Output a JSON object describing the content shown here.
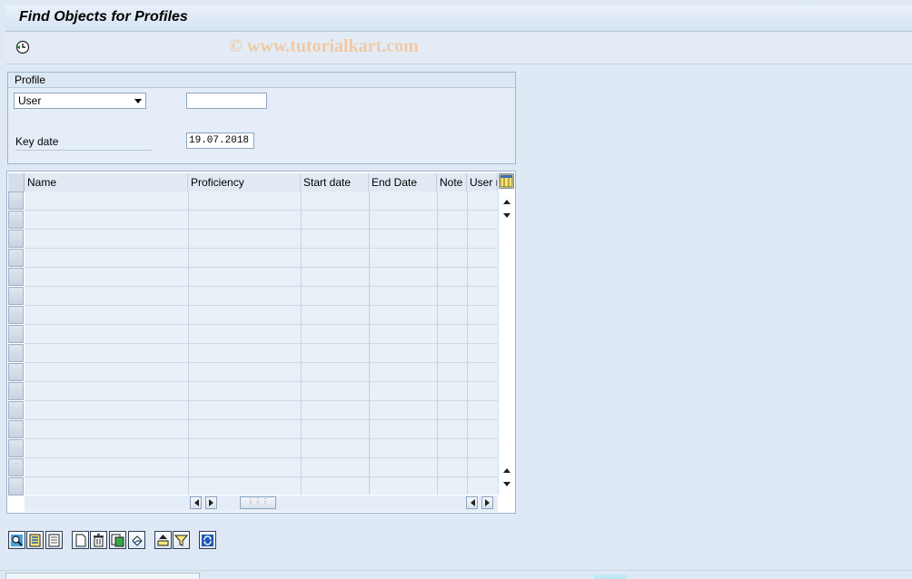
{
  "window": {
    "title": "Find Objects for Profiles"
  },
  "watermark": "© www.tutorialkart.com",
  "app_toolbar": {
    "execute_icon": "execute-clock-icon"
  },
  "profile_group": {
    "title": "Profile",
    "type_select": {
      "value": "User"
    },
    "object_input": {
      "value": ""
    },
    "key_date": {
      "label": "Key date",
      "value": "19.07.2018"
    }
  },
  "grid": {
    "columns": [
      "Name",
      "Proficiency",
      "Start date",
      "End Date",
      "Note",
      "User r"
    ],
    "layout_icon": "column-layout-icon",
    "rows": []
  },
  "bottom_toolbar": {
    "buttons": [
      {
        "name": "details-button",
        "icon": "magnifier-icon"
      },
      {
        "name": "select-all-button",
        "icon": "select-all-icon"
      },
      {
        "name": "deselect-all-button",
        "icon": "deselect-icon"
      },
      {
        "name": "create-button",
        "icon": "new-document-icon"
      },
      {
        "name": "delete-button",
        "icon": "trash-icon"
      },
      {
        "name": "copy-button",
        "icon": "copy-icon"
      },
      {
        "name": "undo-button",
        "icon": "undo-icon"
      },
      {
        "name": "sort-button",
        "icon": "sort-icon"
      },
      {
        "name": "filter-button",
        "icon": "filter-icon"
      },
      {
        "name": "refresh-button",
        "icon": "refresh-icon"
      }
    ]
  },
  "colors": {
    "background": "#dfe9f5",
    "grid_row": "#e8f0f8",
    "watermark": "#f1c9a5"
  }
}
